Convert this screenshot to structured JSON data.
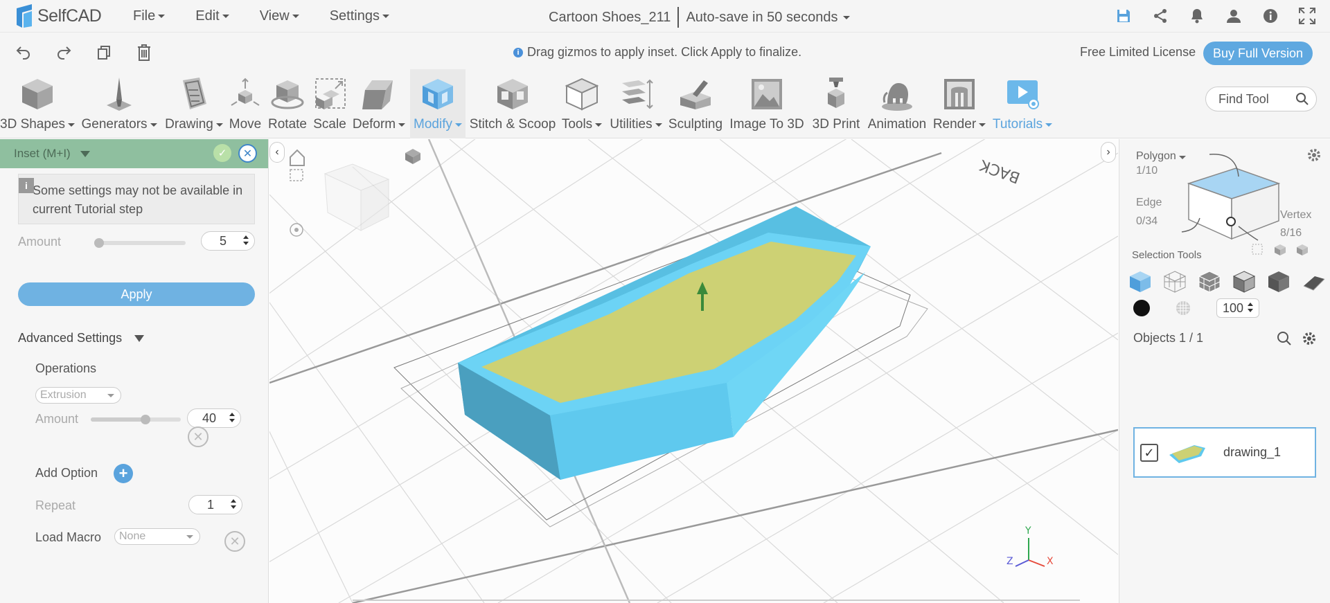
{
  "app": {
    "name": "SelfCAD"
  },
  "menu": {
    "file": "File",
    "edit": "Edit",
    "view": "View",
    "settings": "Settings"
  },
  "document": {
    "title": "Cartoon Shoes_211",
    "autosave": "Auto-save in 50 seconds"
  },
  "top_icons": [
    "save-icon",
    "share-icon",
    "bell-icon",
    "user-icon",
    "info-icon",
    "fullscreen-icon"
  ],
  "actionbar": {
    "hint": "Drag gizmos to apply inset. Click Apply to finalize.",
    "license": "Free Limited License",
    "buy_label": "Buy Full Version"
  },
  "ribbon": {
    "tools": [
      {
        "label": "3D Shapes",
        "dropdown": true
      },
      {
        "label": "Generators",
        "dropdown": true
      },
      {
        "label": "Drawing",
        "dropdown": true
      },
      {
        "label": "Move",
        "dropdown": false
      },
      {
        "label": "Rotate",
        "dropdown": false
      },
      {
        "label": "Scale",
        "dropdown": false
      },
      {
        "label": "Deform",
        "dropdown": true
      },
      {
        "label": "Modify",
        "dropdown": true,
        "active": true
      },
      {
        "label": "Stitch & Scoop",
        "dropdown": false
      },
      {
        "label": "Tools",
        "dropdown": true
      },
      {
        "label": "Utilities",
        "dropdown": true
      },
      {
        "label": "Sculpting",
        "dropdown": false
      },
      {
        "label": "Image To 3D",
        "dropdown": false
      },
      {
        "label": "3D Print",
        "dropdown": false
      },
      {
        "label": "Animation",
        "dropdown": false
      },
      {
        "label": "Render",
        "dropdown": true
      },
      {
        "label": "Tutorials",
        "dropdown": true
      }
    ],
    "find_placeholder": "Find Tool"
  },
  "inset_panel": {
    "title": "Inset (M+I)",
    "notice": "Some settings may not be available in current Tutorial step",
    "amount_label": "Amount",
    "amount_value": "5",
    "amount_fraction": 0.0,
    "apply_label": "Apply",
    "advanced_label": "Advanced Settings",
    "operations_label": "Operations",
    "operation_value": "Extrusion",
    "op_amount_label": "Amount",
    "op_amount_value": "40",
    "op_amount_fraction": 0.62,
    "add_option_label": "Add Option",
    "repeat_label": "Repeat",
    "repeat_value": "1",
    "load_macro_label": "Load Macro",
    "load_macro_value": "None"
  },
  "viewport": {
    "back_label": "BACK",
    "axes": {
      "x": "X",
      "y": "Y",
      "z": "Z"
    }
  },
  "colors": {
    "accent": "#5aa3dd",
    "panel_header": "#8fbf9f",
    "mesh_side": "#5fcbee",
    "mesh_top": "#cdd174"
  },
  "right_panel": {
    "polygon_label": "Polygon",
    "polygon_count": "1/10",
    "edge_label": "Edge",
    "edge_count": "0/34",
    "vertex_label": "Vertex",
    "vertex_count": "8/16",
    "selection_tools_label": "Selection Tools",
    "opacity_value": "100",
    "objects_label": "Objects 1 / 1",
    "object_name": "drawing_1"
  }
}
